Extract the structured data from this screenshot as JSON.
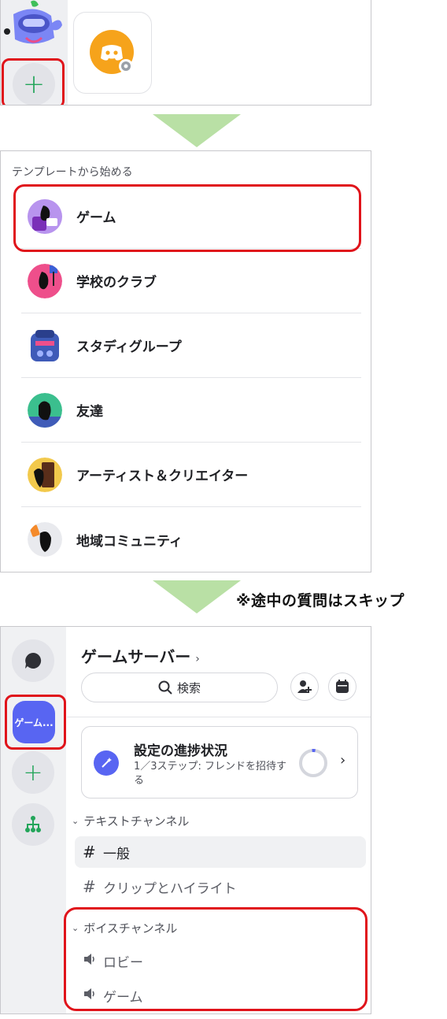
{
  "panel1": {
    "add_label": "+"
  },
  "templates": {
    "heading": "テンプレートから始める",
    "items": [
      {
        "label": "ゲーム",
        "icon": "game-template-icon",
        "color": "#9b6bd6"
      },
      {
        "label": "学校のクラブ",
        "icon": "school-club-template-icon",
        "color": "#e84d8a"
      },
      {
        "label": "スタディグループ",
        "icon": "study-group-template-icon",
        "color": "#3f5bb8"
      },
      {
        "label": "友達",
        "icon": "friends-template-icon",
        "color": "#3bbf8e"
      },
      {
        "label": "アーティスト＆クリエイター",
        "icon": "artists-template-icon",
        "color": "#f2c94c"
      },
      {
        "label": "地域コミュニティ",
        "icon": "local-community-template-icon",
        "color": "#e6e6e6"
      }
    ]
  },
  "note": "※途中の質問はスキップ",
  "server": {
    "rail_server_label": "ゲーム...",
    "rail_add_label": "+",
    "title": "ゲームサーバー",
    "title_chevron": "›",
    "search_label": "検索",
    "progress": {
      "title": "設定の進捗状況",
      "subtitle": "1／3ステップ: フレンドを招待する",
      "fraction": 0.333
    },
    "text_category": "テキストチャンネル",
    "text_channels": [
      {
        "name": "一般",
        "active": true
      },
      {
        "name": "クリップとハイライト",
        "active": false
      }
    ],
    "voice_category": "ボイスチャンネル",
    "voice_channels": [
      {
        "name": "ロビー"
      },
      {
        "name": "ゲーム"
      }
    ]
  },
  "colors": {
    "highlight": "#e0141b",
    "blurple": "#5865f2",
    "green": "#23a55a",
    "arrow": "#b9e0a5"
  }
}
